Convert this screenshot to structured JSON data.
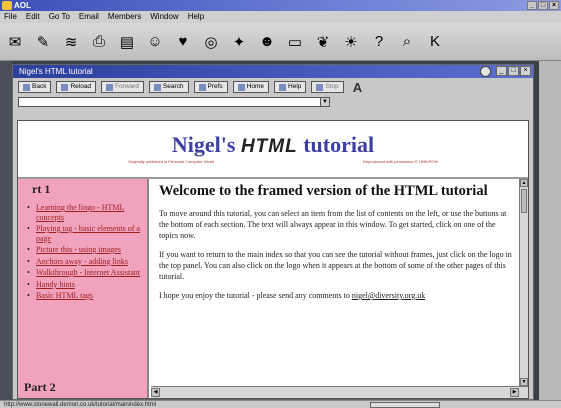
{
  "aol": {
    "title": "AOL",
    "menu": [
      "File",
      "Edit",
      "Go To",
      "Email",
      "Members",
      "Window",
      "Help"
    ]
  },
  "toolbar_icons": [
    "read-mail-icon",
    "write-icon",
    "mail-center-icon",
    "print-icon",
    "my-files-icon",
    "my-aol-icon",
    "favorites-icon",
    "internet-icon",
    "channels-icon",
    "people-icon",
    "quotes-icon",
    "perks-icon",
    "weather-icon",
    "help-icon",
    "find-icon",
    "keyword-icon"
  ],
  "window": {
    "title": "Nigel's HTML tutorial"
  },
  "nav": {
    "buttons": [
      "Back",
      "Reload",
      "Forward",
      "Search",
      "Prefs",
      "Home",
      "Help",
      "Stop"
    ]
  },
  "banner": {
    "title_pre": "Nigel's",
    "title_html": "HTML",
    "title_post": "tutorial",
    "sub_left": "Originally published in Personal Computer World",
    "sub_right": "Reproduced with permission © 1996 PCW"
  },
  "sidebar": {
    "part1": "rt 1",
    "part2": "Part 2",
    "items": [
      "Learning the lingo - HTML concepts",
      "Playing tag - basic elements of a page",
      "Picture this - using images",
      "Anchors away - adding links",
      "Walkthrough - Internet Assistant",
      "Handy hints",
      "Basic HTML tags"
    ]
  },
  "main": {
    "heading": "Welcome to the framed version of the HTML tutorial",
    "p1": "To move around this tutorial, you can select an item from the list of contents on the left, or use the buttons at the bottom of each section. The text will always appear in this window. To get started, click on one of the topics now.",
    "p2": "If you want to return to the main index so that you can see the tutorial without frames, just click on the logo in the top panel. You can also click on the logo when it appears at the bottom of some of the other pages of this tutorial.",
    "p3_pre": "I hope you enjoy the tutorial - please send any comments to ",
    "email": "nigel@diversity.org.uk"
  },
  "status": {
    "url": "http://www.stonewall.demon.co.uk/tutorial/mainindex.html"
  }
}
